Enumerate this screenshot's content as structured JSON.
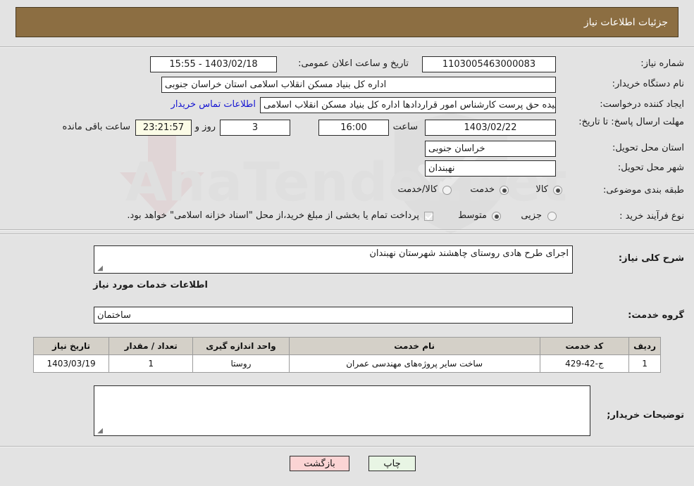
{
  "header": {
    "title": "جزئیات اطلاعات نیاز",
    "bar_color": "#8c6e42"
  },
  "watermark": {
    "text": "AnaTender.net"
  },
  "top_form": {
    "need_number_label": "شماره نیاز:",
    "need_number_value": "1103005463000083",
    "public_announce_label": "تاریخ و ساعت اعلان عمومی:",
    "public_announce_value": "1403/02/18 - 15:55",
    "buyer_org_label": "نام دستگاه خریدار:",
    "buyer_org_value": "اداره کل بنیاد مسکن انقلاب اسلامی استان خراسان جنوبی",
    "request_creator_label": "ایجاد کننده درخواست:",
    "request_creator_value": "حمیده حق پرست کارشناس امور قراردادها اداره کل بنیاد مسکن انقلاب اسلامی",
    "buyer_contact_link": "اطلاعات تماس خریدار",
    "deadline_label": "مهلت ارسال پاسخ: تا تاریخ:",
    "deadline_date": "1403/02/22",
    "deadline_hour_label": "ساعت",
    "deadline_hour": "16:00",
    "remaining_days": "3",
    "remaining_days_suffix": "روز و",
    "remaining_time": "23:21:57",
    "remaining_time_suffix": "ساعت باقی مانده",
    "province_label": "استان محل تحویل:",
    "province_value": "خراسان جنوبی",
    "city_label": "شهر محل تحویل:",
    "city_value": "نهبندان",
    "category_label": "طبقه بندی موضوعی:",
    "category_options": [
      {
        "label": "کالا",
        "selected": false
      },
      {
        "label": "خدمت",
        "selected": true
      },
      {
        "label": "کالا/خدمت",
        "selected": false
      }
    ],
    "process_label": "نوع فرآیند خرید :",
    "process_options": [
      {
        "label": "جزیی",
        "selected": false
      },
      {
        "label": "متوسط",
        "selected": true
      }
    ],
    "treasury_checkbox_checked": true,
    "treasury_note": "پرداخت تمام یا بخشی از مبلغ خرید،از محل \"اسناد خزانه اسلامی\" خواهد بود."
  },
  "description": {
    "label": "شرح کلی نیاز:",
    "value": "اجرای طرح هادی روستای چاهشند شهرستان نهبندان"
  },
  "services": {
    "section_title": "اطلاعات خدمات مورد نیاز",
    "group_label": "گروه خدمت:",
    "group_value": "ساختمان",
    "columns": [
      "ردیف",
      "کد خدمت",
      "نام خدمت",
      "واحد اندازه گیری",
      "تعداد / مقدار",
      "تاریخ نیاز"
    ],
    "rows": [
      {
        "row": "1",
        "code": "ج-42-429",
        "name": "ساخت سایر پروژه‌های مهندسی عمران",
        "unit": "روستا",
        "quantity": "1",
        "need_date": "1403/03/19"
      }
    ]
  },
  "buyer_notes": {
    "label": "توضیحات خریدار;",
    "value": ""
  },
  "footer": {
    "print_label": "چاپ",
    "back_label": "بازگشت"
  }
}
